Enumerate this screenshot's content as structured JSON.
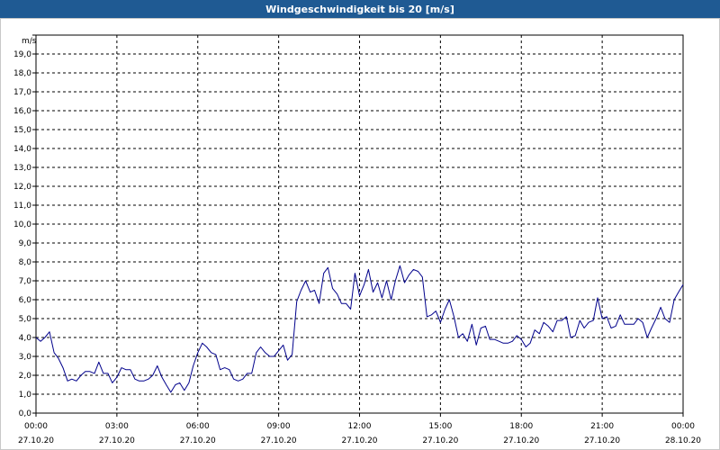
{
  "window": {
    "title": "Windgeschwindigkeit bis 20 [m/s]"
  },
  "colors": {
    "titlebar": "#1f5a93",
    "series": "#00008b",
    "grid": "#000000"
  },
  "chart_data": {
    "type": "line",
    "title": "Windgeschwindigkeit bis 20 [m/s]",
    "ylabel": "m/s",
    "xlabel": "",
    "ylim": [
      0,
      20
    ],
    "yticks": [
      "0,0",
      "1,0",
      "2,0",
      "3,0",
      "4,0",
      "5,0",
      "6,0",
      "7,0",
      "8,0",
      "9,0",
      "10,0",
      "11,0",
      "12,0",
      "13,0",
      "14,0",
      "15,0",
      "16,0",
      "17,0",
      "18,0",
      "19,0"
    ],
    "xlim_hours": [
      0,
      24
    ],
    "xticks": [
      {
        "time": "00:00",
        "date": "27.10.20"
      },
      {
        "time": "03:00",
        "date": "27.10.20"
      },
      {
        "time": "06:00",
        "date": "27.10.20"
      },
      {
        "time": "09:00",
        "date": "27.10.20"
      },
      {
        "time": "12:00",
        "date": "27.10.20"
      },
      {
        "time": "15:00",
        "date": "27.10.20"
      },
      {
        "time": "18:00",
        "date": "27.10.20"
      },
      {
        "time": "21:00",
        "date": "27.10.20"
      },
      {
        "time": "00:00",
        "date": "28.10.20"
      }
    ],
    "grid": true,
    "series": [
      {
        "x": [
          0.0,
          0.17,
          0.33,
          0.5,
          0.67,
          0.83,
          1.0,
          1.17,
          1.33,
          1.5,
          1.67,
          1.83,
          2.0,
          2.17,
          2.33,
          2.5,
          2.67,
          2.83,
          3.0,
          3.17,
          3.33,
          3.5,
          3.67,
          3.83,
          4.0,
          4.17,
          4.33,
          4.5,
          4.67,
          4.83,
          5.0,
          5.17,
          5.33,
          5.5,
          5.67,
          5.83,
          6.0,
          6.17,
          6.33,
          6.5,
          6.67,
          6.83,
          7.0,
          7.17,
          7.33,
          7.5,
          7.67,
          7.83,
          8.0,
          8.17,
          8.33,
          8.5,
          8.67,
          8.83,
          9.0,
          9.17,
          9.33,
          9.5,
          9.67,
          9.83,
          10.0,
          10.17,
          10.33,
          10.5,
          10.67,
          10.83,
          11.0,
          11.17,
          11.33,
          11.5,
          11.67,
          11.83,
          12.0,
          12.17,
          12.33,
          12.5,
          12.67,
          12.83,
          13.0,
          13.17,
          13.33,
          13.5,
          13.67,
          13.83,
          14.0,
          14.17,
          14.33,
          14.5,
          14.67,
          14.83,
          15.0,
          15.17,
          15.33,
          15.5,
          15.67,
          15.83,
          16.0,
          16.17,
          16.33,
          16.5,
          16.67,
          16.83,
          17.0,
          17.17,
          17.33,
          17.5,
          17.67,
          17.83,
          18.0,
          18.17,
          18.33,
          18.5,
          18.67,
          18.83,
          19.0,
          19.17,
          19.33,
          19.5,
          19.67,
          19.83,
          20.0,
          20.17,
          20.33,
          20.5,
          20.67,
          20.83,
          21.0,
          21.17,
          21.33,
          21.5,
          21.67,
          21.83,
          22.0,
          22.17,
          22.33,
          22.5,
          22.67,
          22.83,
          23.0,
          23.17,
          23.33,
          23.5,
          23.67,
          23.83,
          24.0
        ],
        "values": [
          4.0,
          3.8,
          4.0,
          4.3,
          3.2,
          2.9,
          2.4,
          1.7,
          1.8,
          1.7,
          2.0,
          2.2,
          2.2,
          2.1,
          2.7,
          2.1,
          2.1,
          1.6,
          1.9,
          2.4,
          2.3,
          2.3,
          1.8,
          1.7,
          1.7,
          1.8,
          2.0,
          2.5,
          1.9,
          1.5,
          1.1,
          1.5,
          1.6,
          1.2,
          1.6,
          2.5,
          3.2,
          3.7,
          3.5,
          3.2,
          3.1,
          2.3,
          2.4,
          2.3,
          1.8,
          1.7,
          1.8,
          2.1,
          2.1,
          3.2,
          3.5,
          3.2,
          3.0,
          3.0,
          3.3,
          3.6,
          2.8,
          3.1,
          5.9,
          6.5,
          7.0,
          6.4,
          6.5,
          5.8,
          7.4,
          7.7,
          6.6,
          6.3,
          5.8,
          5.8,
          5.5,
          7.4,
          6.2,
          6.8,
          7.6,
          6.4,
          6.9,
          6.1,
          7.0,
          6.0,
          7.0,
          7.8,
          6.9,
          7.3,
          7.6,
          7.5,
          7.2,
          5.1,
          5.2,
          5.4,
          4.8,
          5.5,
          6.0,
          5.1,
          4.0,
          4.2,
          3.8,
          4.7,
          3.6,
          4.5,
          4.6,
          3.9,
          3.9,
          3.8,
          3.7,
          3.7,
          3.8,
          4.1,
          3.9,
          3.5,
          3.7,
          4.4,
          4.2,
          4.8,
          4.6,
          4.3,
          4.9,
          4.9,
          5.1,
          4.0,
          4.1,
          4.9,
          4.5,
          4.8,
          4.9,
          6.1,
          5.0,
          5.1,
          4.5,
          4.6,
          5.2,
          4.7,
          4.7,
          4.7,
          5.0,
          4.8,
          4.0,
          4.5,
          5.0,
          5.6,
          5.0,
          4.8,
          6.0,
          6.4,
          6.8
        ]
      }
    ]
  }
}
